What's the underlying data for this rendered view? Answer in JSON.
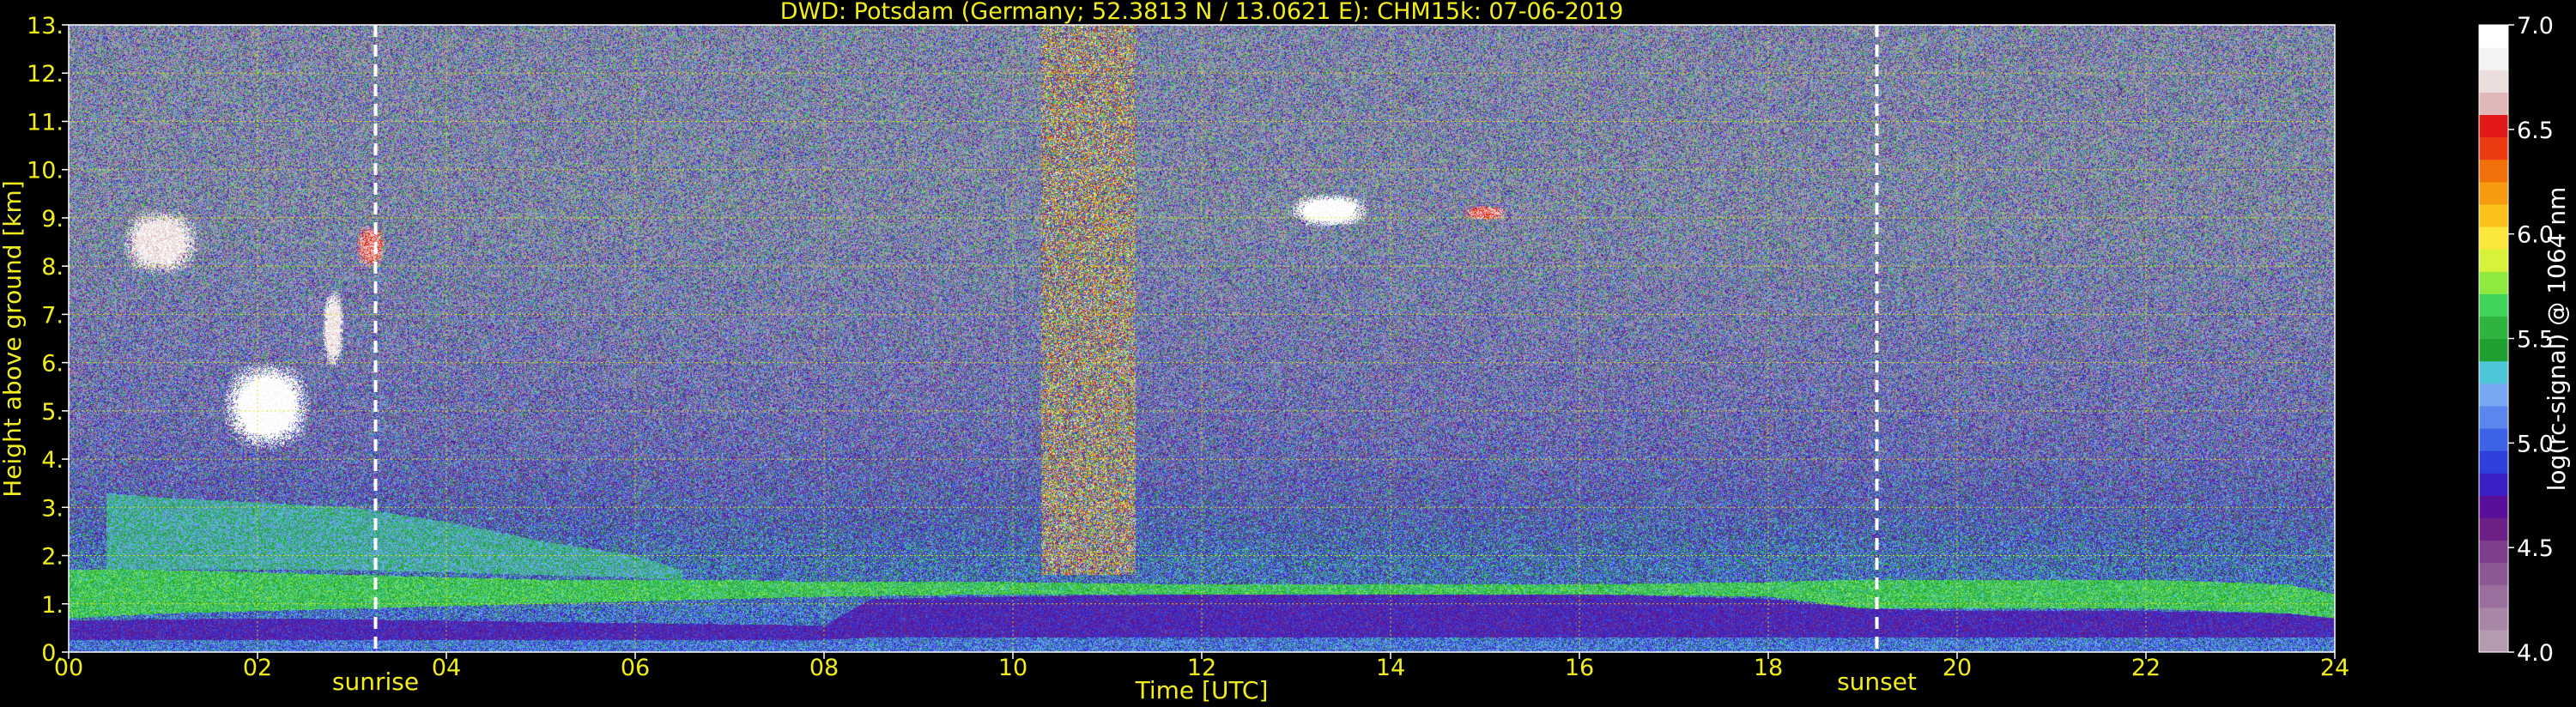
{
  "chart_data": {
    "type": "heatmap",
    "title": "DWD: Potsdam (Germany; 52.3813 N / 13.0621 E):    CHM15k: 07-06-2019",
    "xlabel": "Time [UTC]",
    "ylabel": "Height above ground [km]",
    "xlim": [
      0,
      24
    ],
    "ylim": [
      0,
      13
    ],
    "x_ticks": [
      "00",
      "02",
      "04",
      "06",
      "08",
      "10",
      "12",
      "14",
      "16",
      "18",
      "20",
      "22",
      "24"
    ],
    "y_ticks": [
      "0.",
      "1.",
      "2.",
      "3.",
      "4.",
      "5.",
      "6.",
      "7.",
      "8.",
      "9.",
      "10.",
      "11.",
      "12.",
      "13."
    ],
    "grid": true,
    "grid_color": "#e6e600",
    "colorbar": {
      "label": "log(rc-signal) @ 1064 nm",
      "range": [
        4.0,
        7.0
      ],
      "ticks": [
        "4.0",
        "4.5",
        "5.0",
        "5.5",
        "6.0",
        "6.5",
        "7.0"
      ],
      "colors": [
        "#b59bb0",
        "#a786a6",
        "#9a6f9d",
        "#8c5894",
        "#7d3f8c",
        "#6c1f85",
        "#5a0f9a",
        "#3a1fc4",
        "#2f3fdc",
        "#3f63e6",
        "#5a86ee",
        "#78a8f2",
        "#4fc6d8",
        "#1f9f2f",
        "#2fb43f",
        "#3fd35a",
        "#8fea3f",
        "#d8f23a",
        "#fbe63a",
        "#fbc31a",
        "#f69a10",
        "#f2700a",
        "#ec3a12",
        "#e41818",
        "#e0b8b8",
        "#eddede",
        "#f4f4f4",
        "#ffffff"
      ]
    },
    "annotations": [
      {
        "label": "sunrise",
        "x": 3.25
      },
      {
        "label": "sunset",
        "x": 19.15
      }
    ],
    "layers": [
      {
        "name": "near-surface",
        "t": [
          0,
          2,
          4,
          6,
          8,
          8.5,
          10,
          12,
          14,
          16,
          18,
          19,
          20,
          22,
          23.5,
          24
        ],
        "bottom": [
          0.25,
          0.25,
          0.25,
          0.25,
          0.25,
          0.3,
          0.3,
          0.3,
          0.3,
          0.3,
          0.3,
          0.3,
          0.3,
          0.3,
          0.3,
          0.3
        ],
        "top": [
          0.65,
          0.7,
          0.65,
          0.6,
          0.55,
          1.1,
          1.15,
          1.2,
          1.2,
          1.2,
          1.1,
          0.9,
          0.85,
          0.85,
          0.8,
          0.7
        ],
        "level": 4.75
      },
      {
        "name": "residual-layer",
        "t": [
          0,
          1,
          2,
          3,
          4,
          5,
          6,
          7,
          8,
          10,
          12,
          14,
          16,
          18,
          19,
          20,
          22,
          23.5,
          24
        ],
        "bottom": [
          0.7,
          0.8,
          0.85,
          0.9,
          0.95,
          1.0,
          1.05,
          1.1,
          1.15,
          1.2,
          1.2,
          1.2,
          1.2,
          1.15,
          0.9,
          0.9,
          0.9,
          0.8,
          0.7
        ],
        "top": [
          1.7,
          1.7,
          1.65,
          1.6,
          1.55,
          1.5,
          1.5,
          1.5,
          1.45,
          1.45,
          1.4,
          1.4,
          1.4,
          1.45,
          1.5,
          1.5,
          1.5,
          1.4,
          1.2
        ],
        "level": 5.55
      },
      {
        "name": "aerosol-layer",
        "t": [
          0.4,
          1,
          2,
          3,
          4,
          5,
          6,
          6.5
        ],
        "bottom": [
          1.7,
          1.7,
          1.7,
          1.7,
          1.65,
          1.6,
          1.55,
          1.5
        ],
        "top": [
          3.3,
          3.2,
          3.1,
          3.0,
          2.7,
          2.3,
          2.0,
          1.7
        ],
        "level": 5.35
      }
    ],
    "clouds": [
      {
        "t0": 0.45,
        "t1": 1.5,
        "bottom": 7.6,
        "top": 9.4,
        "level": 6.8
      },
      {
        "t0": 1.5,
        "t1": 2.7,
        "bottom": 3.9,
        "top": 6.3,
        "level": 7.0
      },
      {
        "t0": 2.65,
        "t1": 2.95,
        "bottom": 5.6,
        "top": 7.8,
        "level": 6.8
      },
      {
        "t0": 3.0,
        "t1": 3.4,
        "bottom": 7.8,
        "top": 9.0,
        "level": 6.6
      },
      {
        "t0": 12.8,
        "t1": 13.9,
        "bottom": 8.7,
        "top": 9.6,
        "level": 7.0
      },
      {
        "t0": 14.7,
        "t1": 15.3,
        "bottom": 8.9,
        "top": 9.3,
        "level": 6.6
      }
    ],
    "noisy_sky_periods": [
      {
        "t0": 10.3,
        "t1": 11.3,
        "level": 6.4
      }
    ]
  }
}
